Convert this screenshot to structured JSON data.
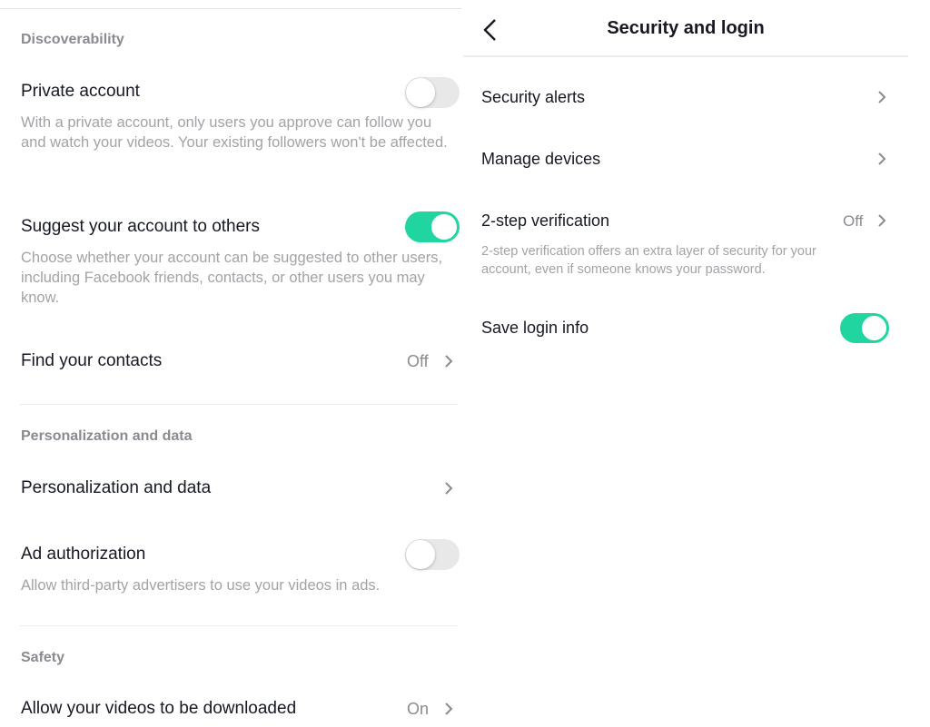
{
  "left_panel": {
    "sections": [
      {
        "title": "Discoverability",
        "rows": [
          {
            "label": "Private account",
            "description": "With a private account, only users you approve can follow you and watch your videos. Your existing followers won't be affected.",
            "control": "toggle",
            "enabled": false
          },
          {
            "label": "Suggest your account to others",
            "description": "Choose whether your account can be suggested to other users, including Facebook friends, contacts, or other users you may know.",
            "control": "toggle",
            "enabled": true
          },
          {
            "label": "Find your contacts",
            "value": "Off",
            "control": "chevron"
          }
        ]
      },
      {
        "title": "Personalization and data",
        "rows": [
          {
            "label": "Personalization and data",
            "control": "chevron"
          },
          {
            "label": "Ad authorization",
            "description": "Allow third-party advertisers to use your videos in ads.",
            "control": "toggle",
            "enabled": false
          }
        ]
      },
      {
        "title": "Safety",
        "rows": [
          {
            "label": "Allow your videos to be downloaded",
            "value": "On",
            "control": "chevron"
          }
        ]
      }
    ]
  },
  "right_panel": {
    "header": {
      "title": "Security and login",
      "back_icon": "chevron-left-icon"
    },
    "rows": [
      {
        "label": "Security alerts",
        "control": "chevron"
      },
      {
        "label": "Manage devices",
        "control": "chevron"
      },
      {
        "label": "2-step verification",
        "value": "Off",
        "description": "2-step verification offers an extra layer of security for your account, even if someone knows your password.",
        "control": "chevron"
      },
      {
        "label": "Save login info",
        "control": "toggle",
        "enabled": true
      }
    ]
  },
  "colors": {
    "accent_toggle_on": "#20d5a0",
    "toggle_off": "#e8e8e9",
    "primary_text": "#161823",
    "secondary_text": "#a2a3a7",
    "section_header_text": "#8a8b91"
  }
}
